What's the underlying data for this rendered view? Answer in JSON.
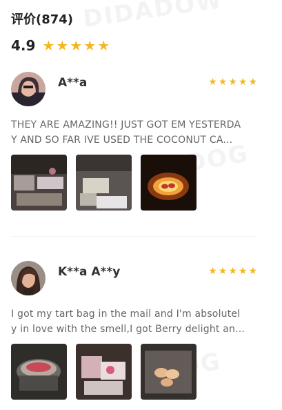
{
  "reviews_section": {
    "title": "评价(874)",
    "average_rating": "4.9",
    "average_stars": 5
  },
  "reviews": [
    {
      "user": "A**a",
      "stars": 5,
      "text": "THEY ARE AMAZING!! JUST GOT EM YESTERDAY AND SO FAR IVE USED THE COCONUT CA...",
      "photos": [
        "candle-items-photo",
        "wax-bags-photo",
        "wax-warmer-photo"
      ]
    },
    {
      "user": "K**a A**y",
      "stars": 5,
      "text": "I got my tart bag in the mail and I'm absolutely in love with the smell,I got Berry delight an...",
      "photos": [
        "wax-melter-photo",
        "pink-wax-bags-photo",
        "wax-melts-bag-photo"
      ]
    }
  ],
  "icons": {
    "star": "star-icon"
  },
  "colors": {
    "star": "#f5b71e",
    "text": "#666666",
    "title": "#222222"
  }
}
